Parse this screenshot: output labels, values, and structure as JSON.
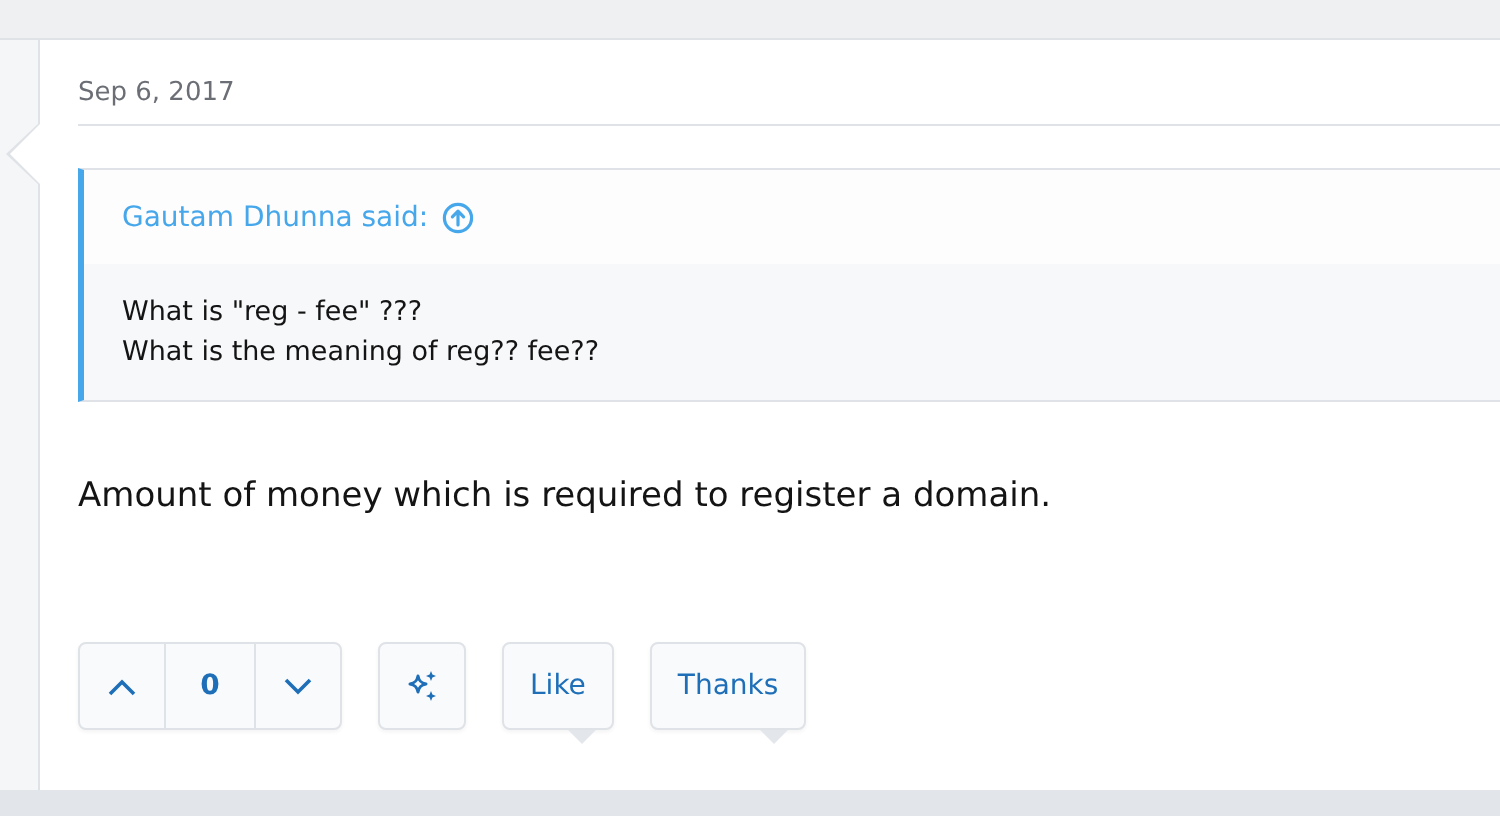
{
  "post": {
    "date": "Sep 6, 2017",
    "quote": {
      "attribution": "Gautam Dhunna said:",
      "lines": [
        "What is \"reg - fee\" ???",
        "What is the meaning of reg?? fee??"
      ]
    },
    "message": "Amount of money which is required to register a domain.",
    "votes": {
      "count": "0"
    },
    "reactions": [
      {
        "label": "Like"
      },
      {
        "label": "Thanks"
      }
    ]
  }
}
